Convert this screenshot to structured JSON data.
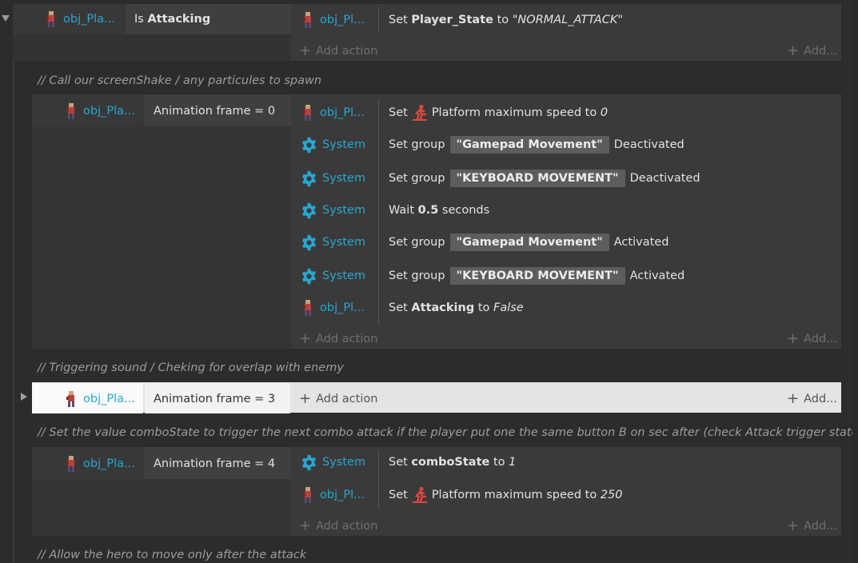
{
  "colors": {
    "background": "#2c2c2c",
    "object_link": "#2aa6cf",
    "accent_run": "#e0473f",
    "gear": "#2aa6cf"
  },
  "common": {
    "add_action": "Add action",
    "add": "Add..."
  },
  "event1": {
    "condition_object": "obj_Pla...",
    "condition_is": "Is",
    "condition_var": "Attacking",
    "action": {
      "object": "obj_Pl...",
      "set": "Set",
      "var": "Player_State",
      "to": "to",
      "value": "\"NORMAL_ATTACK\""
    }
  },
  "comment1": "//  Call our screenShake / any particules to spawn",
  "event2": {
    "condition_object": "obj_Pla...",
    "condition_text": "Animation frame = 0",
    "actions": [
      {
        "object": "obj_Pl...",
        "set": "Set",
        "text": "Platform maximum speed to",
        "value": "0"
      },
      {
        "object": "System",
        "set": "Set group",
        "group": "\"Gamepad Movement\"",
        "state": "Deactivated"
      },
      {
        "object": "System",
        "set": "Set group",
        "group": "\"KEYBOARD MOVEMENT\"",
        "state": "Deactivated"
      },
      {
        "object": "System",
        "wait": "Wait",
        "value": "0.5",
        "unit": "seconds"
      },
      {
        "object": "System",
        "set": "Set group",
        "group": "\"Gamepad Movement\"",
        "state": "Activated"
      },
      {
        "object": "System",
        "set": "Set group",
        "group": "\"KEYBOARD MOVEMENT\"",
        "state": "Activated"
      },
      {
        "object": "obj_Pl...",
        "set": "Set",
        "var": "Attacking",
        "to": "to",
        "value": "False"
      }
    ]
  },
  "comment2": "//  Triggering sound / Cheking for overlap with enemy",
  "event3": {
    "condition_object": "obj_Pla...",
    "condition_text": "Animation frame = 3"
  },
  "comment3": "//  Set the value comboState to trigger the next combo attack if the player put one the same button B on sec after (check Attack trigger state )",
  "event4": {
    "condition_object": "obj_Pla...",
    "condition_text": "Animation frame = 4",
    "actions": [
      {
        "object": "System",
        "set": "Set",
        "var": "comboState",
        "to": "to",
        "value": "1"
      },
      {
        "object": "obj_Pl...",
        "set": "Set",
        "text": "Platform maximum speed to",
        "value": "250"
      }
    ]
  },
  "comment4": "//  Allow the hero to move only after the attack"
}
